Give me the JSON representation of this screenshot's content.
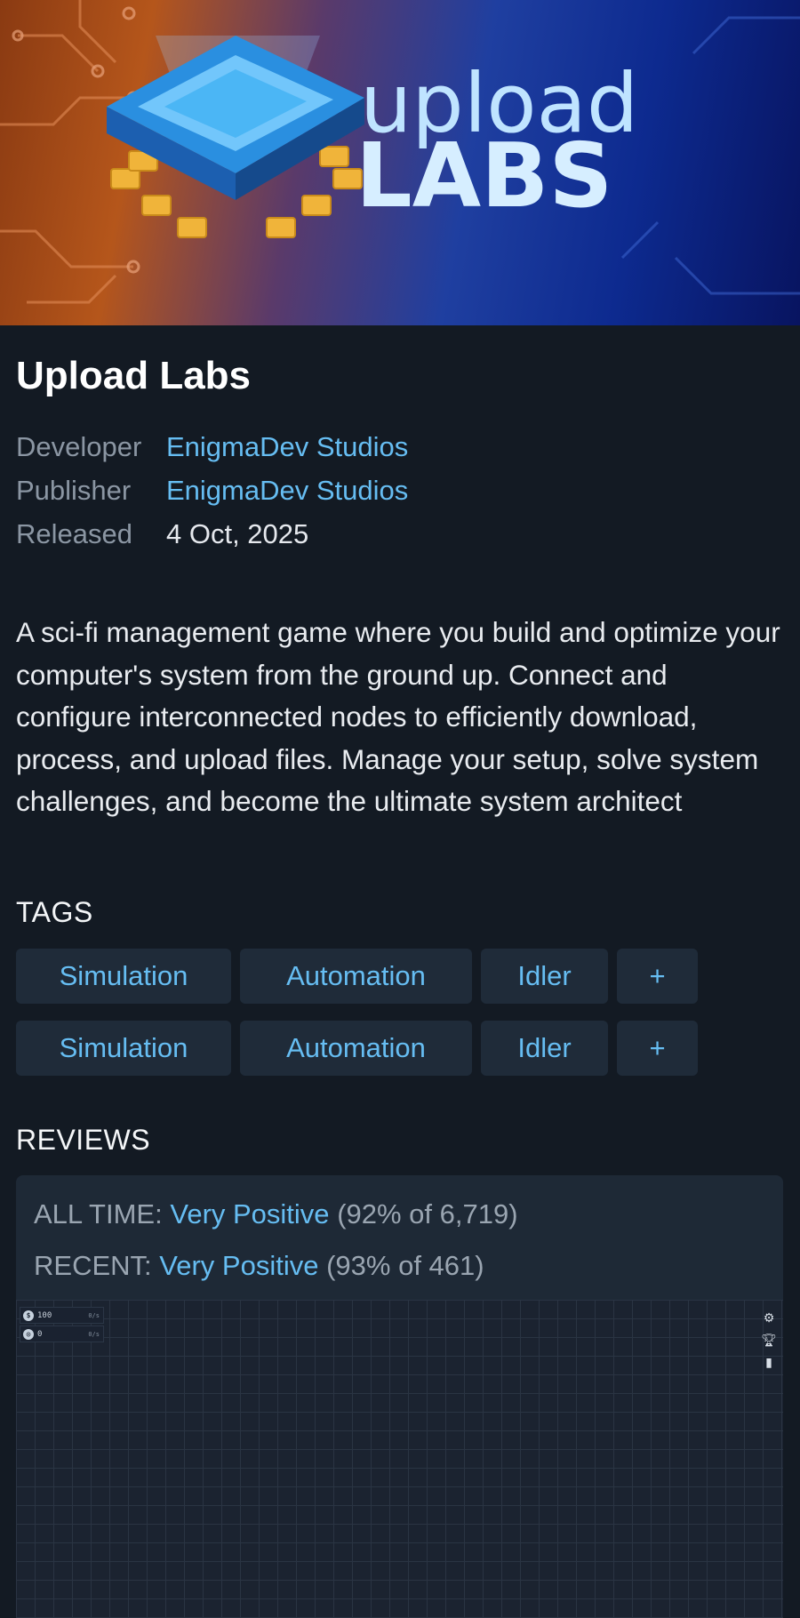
{
  "hero": {
    "logo_text_top": "upload",
    "logo_text_bottom": "LABS"
  },
  "game": {
    "title": "Upload Labs",
    "developer_label": "Developer",
    "developer": "EnigmaDev Studios",
    "publisher_label": "Publisher",
    "publisher": "EnigmaDev Studios",
    "released_label": "Released",
    "released": "4 Oct, 2025",
    "description": "A sci-fi management game where you build and optimize your computer's system from the ground up. Connect and configure interconnected nodes to efficiently download, process, and upload files. Manage your setup, solve system challenges, and become the ultimate system architect"
  },
  "tags": {
    "heading": "TAGS",
    "rows": [
      [
        "Simulation",
        "Automation",
        "Idler",
        "+"
      ],
      [
        "Simulation",
        "Automation",
        "Idler",
        "+"
      ]
    ]
  },
  "reviews": {
    "heading": "REVIEWS",
    "all_time_label": "ALL TIME:",
    "all_time_value": "Very Positive",
    "all_time_detail": "(92% of 6,719)",
    "recent_label": "RECENT:",
    "recent_value": "Very Positive",
    "recent_detail": "(93% of 461)"
  },
  "screenshot_ui": {
    "money_value": "100",
    "money_rate": "0/s",
    "research_value": "0",
    "research_rate": "0/s",
    "icons": [
      "gear-icon",
      "trophy-icon",
      "book-icon"
    ]
  },
  "colors": {
    "background": "#131a23",
    "link": "#66bdf2",
    "tag_background": "#1f2b39",
    "review_box": "#1e2936"
  }
}
